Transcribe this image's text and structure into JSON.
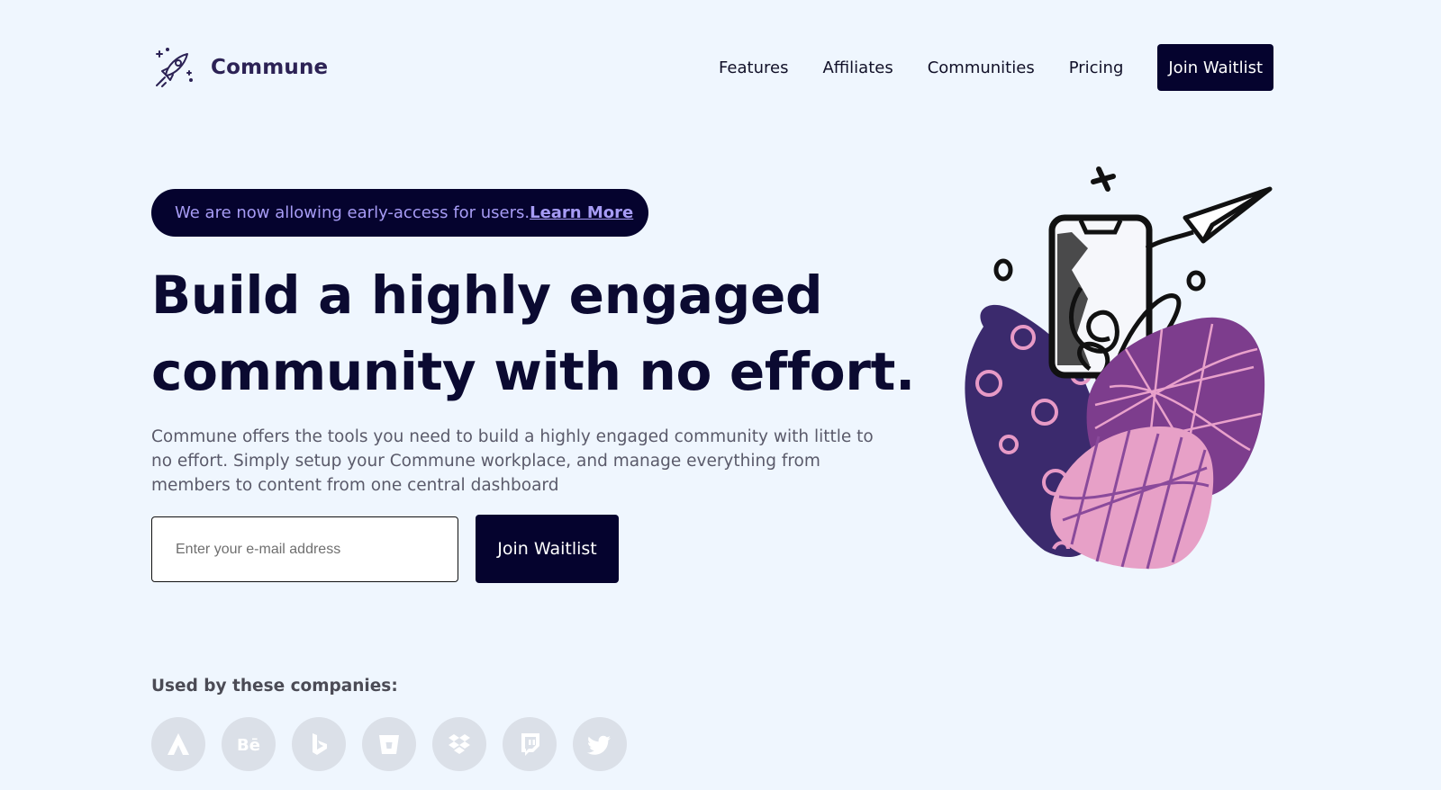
{
  "brand": {
    "name": "Commune",
    "logo_icon": "rocket-icon"
  },
  "nav": {
    "links": [
      {
        "label": "Features"
      },
      {
        "label": "Affiliates"
      },
      {
        "label": "Communities"
      },
      {
        "label": "Pricing"
      }
    ],
    "cta_label": "Join Waitlist"
  },
  "announcement": {
    "text": "We are now allowing early-access for users.",
    "link_label": "Learn More"
  },
  "hero": {
    "title_line1": "Build a highly engaged",
    "title_line2": "community with no effort.",
    "description": "Commune offers the tools you need to build a highly engaged community with little to no effort. Simply setup your Commune workplace, and manage everything from members to content from one central dashboard",
    "email_placeholder": "Enter your e-mail address",
    "email_value": "",
    "join_label": "Join Waitlist"
  },
  "companies": {
    "heading": "Used by these companies:",
    "logos": [
      "airtable-icon",
      "behance-icon",
      "bing-icon",
      "bitbucket-icon",
      "dropbox-icon",
      "twitch-icon",
      "twitter-icon"
    ]
  },
  "colors": {
    "background": "#eff6fe",
    "primary_dark": "#05032e",
    "pill_text": "#a79cf5",
    "logo_circle": "#dbe0e8"
  }
}
